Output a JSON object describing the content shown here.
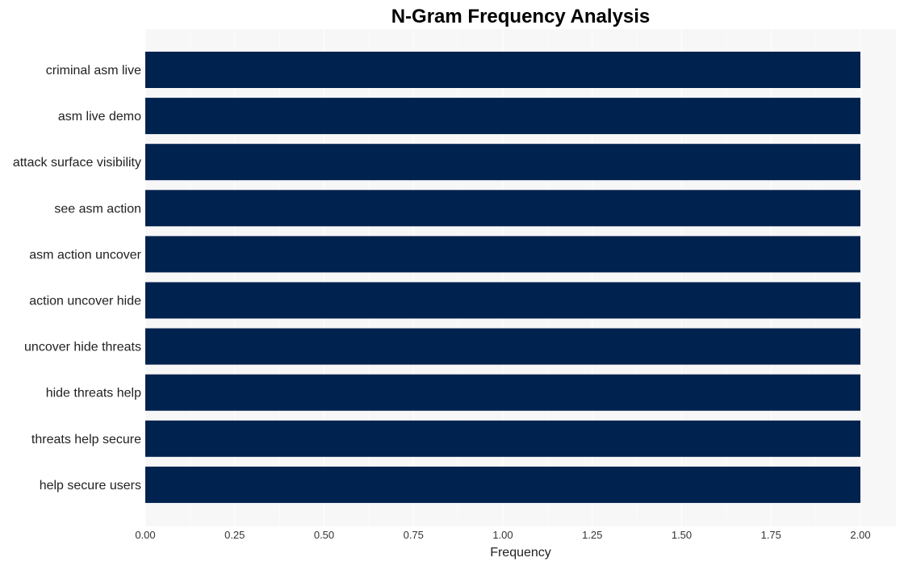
{
  "chart_data": {
    "type": "bar",
    "orientation": "horizontal",
    "title": "N-Gram Frequency Analysis",
    "xlabel": "Frequency",
    "ylabel": "",
    "categories": [
      "criminal asm live",
      "asm live demo",
      "attack surface visibility",
      "see asm action",
      "asm action uncover",
      "action uncover hide",
      "uncover hide threats",
      "hide threats help",
      "threats help secure",
      "help secure users"
    ],
    "values": [
      2,
      2,
      2,
      2,
      2,
      2,
      2,
      2,
      2,
      2
    ],
    "xlim": [
      0,
      2.1
    ],
    "xticks": [
      0,
      0.25,
      0.5,
      0.75,
      1.0,
      1.25,
      1.5,
      1.75,
      2.0
    ],
    "xtick_labels": [
      "0.00",
      "0.25",
      "0.50",
      "0.75",
      "1.00",
      "1.25",
      "1.50",
      "1.75",
      "2.00"
    ],
    "grid": true,
    "legend": "none",
    "colors": {
      "bar": "#00224e",
      "plot_background": "#f7f7f7",
      "grid": "#ffffff"
    }
  }
}
